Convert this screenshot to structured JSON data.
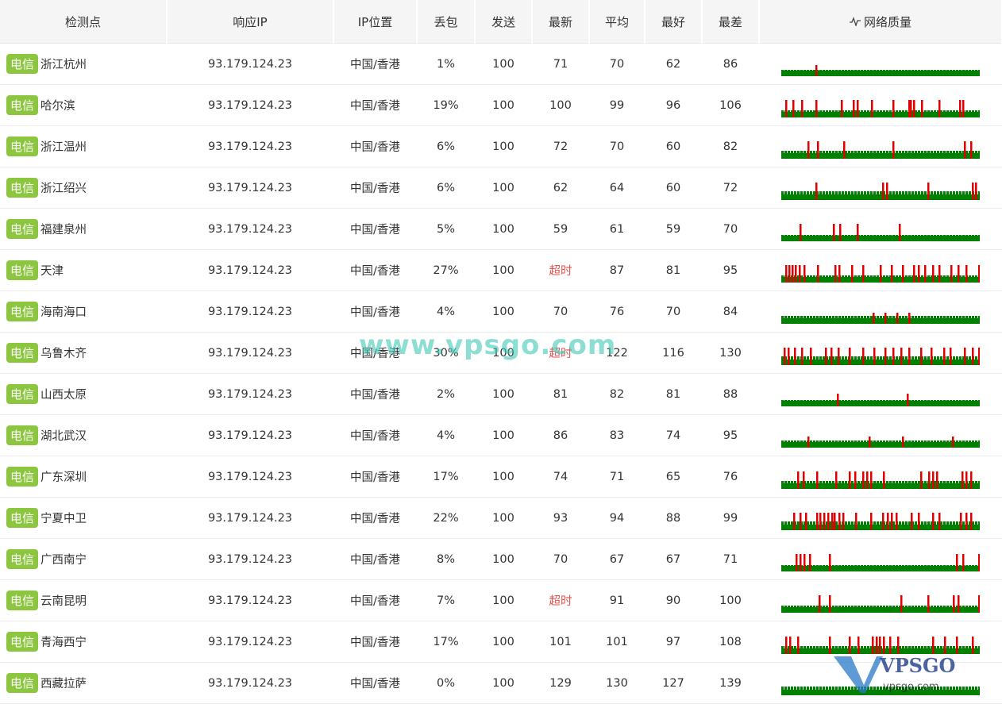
{
  "headers": [
    "检测点",
    "响应IP",
    "IP位置",
    "丢包",
    "发送",
    "最新",
    "平均",
    "最好",
    "最差",
    "网络质量"
  ],
  "header_icon": "pulse-icon",
  "colors": {
    "isp_badge": "#8cc63f",
    "timeout": "#e8504c",
    "quality_ok": "#008000",
    "quality_loss": "#e00000"
  },
  "watermark": "www.vpsgo.com",
  "logo_text": "VPSGO",
  "rows": [
    {
      "isp": "电信",
      "city": "浙江杭州",
      "ip": "93.179.124.23",
      "loc": "中国/香港",
      "loss": "1%",
      "sent": "100",
      "last": "71",
      "avg": "70",
      "best": "62",
      "worst": "86",
      "timeout": false
    },
    {
      "isp": "电信",
      "city": "哈尔滨",
      "ip": "93.179.124.23",
      "loc": "中国/香港",
      "loss": "19%",
      "sent": "100",
      "last": "100",
      "avg": "99",
      "best": "96",
      "worst": "106",
      "timeout": false
    },
    {
      "isp": "电信",
      "city": "浙江温州",
      "ip": "93.179.124.23",
      "loc": "中国/香港",
      "loss": "6%",
      "sent": "100",
      "last": "72",
      "avg": "70",
      "best": "60",
      "worst": "82",
      "timeout": false
    },
    {
      "isp": "电信",
      "city": "浙江绍兴",
      "ip": "93.179.124.23",
      "loc": "中国/香港",
      "loss": "6%",
      "sent": "100",
      "last": "62",
      "avg": "64",
      "best": "60",
      "worst": "72",
      "timeout": false
    },
    {
      "isp": "电信",
      "city": "福建泉州",
      "ip": "93.179.124.23",
      "loc": "中国/香港",
      "loss": "5%",
      "sent": "100",
      "last": "59",
      "avg": "61",
      "best": "59",
      "worst": "70",
      "timeout": false
    },
    {
      "isp": "电信",
      "city": "天津",
      "ip": "93.179.124.23",
      "loc": "中国/香港",
      "loss": "27%",
      "sent": "100",
      "last": "超时",
      "avg": "87",
      "best": "81",
      "worst": "95",
      "timeout": true
    },
    {
      "isp": "电信",
      "city": "海南海口",
      "ip": "93.179.124.23",
      "loc": "中国/香港",
      "loss": "4%",
      "sent": "100",
      "last": "70",
      "avg": "76",
      "best": "70",
      "worst": "84",
      "timeout": false
    },
    {
      "isp": "电信",
      "city": "乌鲁木齐",
      "ip": "93.179.124.23",
      "loc": "中国/香港",
      "loss": "30%",
      "sent": "100",
      "last": "超时",
      "avg": "122",
      "best": "116",
      "worst": "130",
      "timeout": true
    },
    {
      "isp": "电信",
      "city": "山西太原",
      "ip": "93.179.124.23",
      "loc": "中国/香港",
      "loss": "2%",
      "sent": "100",
      "last": "81",
      "avg": "82",
      "best": "81",
      "worst": "88",
      "timeout": false
    },
    {
      "isp": "电信",
      "city": "湖北武汉",
      "ip": "93.179.124.23",
      "loc": "中国/香港",
      "loss": "4%",
      "sent": "100",
      "last": "86",
      "avg": "83",
      "best": "74",
      "worst": "95",
      "timeout": false
    },
    {
      "isp": "电信",
      "city": "广东深圳",
      "ip": "93.179.124.23",
      "loc": "中国/香港",
      "loss": "17%",
      "sent": "100",
      "last": "74",
      "avg": "71",
      "best": "65",
      "worst": "76",
      "timeout": false
    },
    {
      "isp": "电信",
      "city": "宁夏中卫",
      "ip": "93.179.124.23",
      "loc": "中国/香港",
      "loss": "22%",
      "sent": "100",
      "last": "93",
      "avg": "94",
      "best": "88",
      "worst": "99",
      "timeout": false
    },
    {
      "isp": "电信",
      "city": "广西南宁",
      "ip": "93.179.124.23",
      "loc": "中国/香港",
      "loss": "8%",
      "sent": "100",
      "last": "70",
      "avg": "67",
      "best": "67",
      "worst": "71",
      "timeout": false
    },
    {
      "isp": "电信",
      "city": "云南昆明",
      "ip": "93.179.124.23",
      "loc": "中国/香港",
      "loss": "7%",
      "sent": "100",
      "last": "超时",
      "avg": "91",
      "best": "90",
      "worst": "100",
      "timeout": true
    },
    {
      "isp": "电信",
      "city": "青海西宁",
      "ip": "93.179.124.23",
      "loc": "中国/香港",
      "loss": "17%",
      "sent": "100",
      "last": "101",
      "avg": "101",
      "best": "97",
      "worst": "108",
      "timeout": false
    },
    {
      "isp": "电信",
      "city": "西藏拉萨",
      "ip": "93.179.124.23",
      "loc": "中国/香港",
      "loss": "0%",
      "sent": "100",
      "last": "129",
      "avg": "130",
      "best": "127",
      "worst": "139",
      "timeout": false
    }
  ]
}
